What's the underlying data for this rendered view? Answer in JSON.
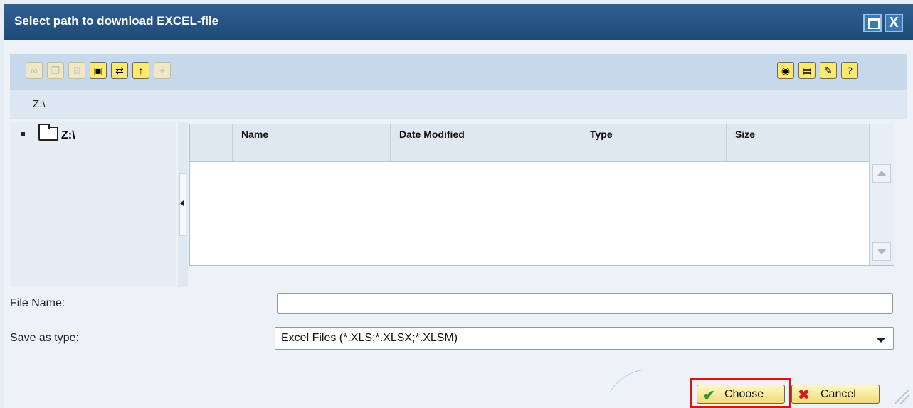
{
  "window": {
    "title": "Select path to download EXCEL-file",
    "maximize_icon": "maximize-icon",
    "close_icon": "close-icon",
    "close_glyph": "X"
  },
  "toolbar": {
    "left_icons": [
      {
        "name": "link-icon",
        "glyph": "∞",
        "enabled": false
      },
      {
        "name": "copy-icon",
        "glyph": "❐",
        "enabled": false
      },
      {
        "name": "delete-icon",
        "glyph": "⌸",
        "enabled": false
      },
      {
        "name": "new-folder-icon",
        "glyph": "▣",
        "enabled": true
      },
      {
        "name": "refresh-icon",
        "glyph": "⇄",
        "enabled": true
      },
      {
        "name": "up-folder-icon",
        "glyph": "↑",
        "enabled": true
      },
      {
        "name": "expand-icon",
        "glyph": "⌖",
        "enabled": false
      }
    ],
    "right_icons": [
      {
        "name": "network-drive-icon",
        "glyph": "◉",
        "enabled": true
      },
      {
        "name": "details-icon",
        "glyph": "▤",
        "enabled": true
      },
      {
        "name": "edit-icon",
        "glyph": "✎",
        "enabled": true
      },
      {
        "name": "help-icon",
        "glyph": "?",
        "enabled": true
      }
    ]
  },
  "path": {
    "current": "Z:\\"
  },
  "tree": {
    "root_label": "Z:\\"
  },
  "file_list": {
    "columns": [
      "Name",
      "Date Modified",
      "Type",
      "Size"
    ],
    "rows": []
  },
  "form": {
    "file_name_label": "File Name:",
    "file_name_value": "",
    "save_as_type_label": "Save as type:",
    "save_as_type_value": "Excel Files (*.XLS;*.XLSX;*.XLSM)"
  },
  "buttons": {
    "choose": "Choose",
    "cancel": "Cancel"
  },
  "colors": {
    "title_bar": "#1f4a78",
    "toolbar_bg": "#c5d8ec",
    "highlight": "#e01010"
  }
}
